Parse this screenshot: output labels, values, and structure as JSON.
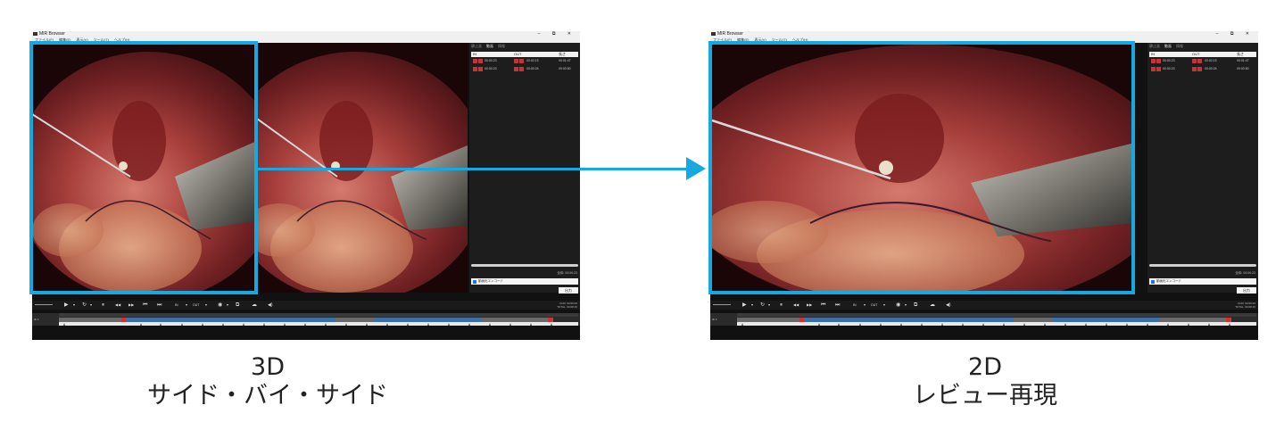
{
  "app": {
    "title": "MIR Browser",
    "window_controls": "– ⧉ ✕",
    "menu": [
      "ファイル(F)",
      "編集(E)",
      "表示(V)",
      "ツール(T)",
      "ヘルプ(H)"
    ],
    "side_tabs": [
      "静止画",
      "動画",
      "情報"
    ],
    "active_tab": 1,
    "clip_columns": [
      "IN",
      "OUT",
      "長さ"
    ],
    "clips": [
      {
        "in": "00:00:23",
        "out": "00:02:15",
        "length": "00:01:47"
      },
      {
        "in": "00:00:23",
        "out": "00:00:24",
        "length": "00:00:50"
      }
    ],
    "side_time": "全体: 00:00:23",
    "encode_label": "動画化エンコード",
    "output_label": "出力",
    "time_readout": [
      "CUR: 00:00:23",
      "TOTAL: 00:08:15"
    ],
    "track_label": "ch 1",
    "control_glyphs": [
      "▶",
      "▾",
      "↻",
      "▾",
      "⏸",
      "◀◀",
      "▶▶",
      "⏮",
      "⏭",
      "IN",
      "▾",
      "OUT",
      "▾",
      "◉",
      "▾",
      "⧉",
      "☁",
      "◀)"
    ]
  },
  "left": {
    "mode": "3D side-by-side"
  },
  "right": {
    "mode": "2D review"
  },
  "captions": {
    "left_line1": "3D",
    "left_line2": "サイド・バイ・サイド",
    "right_line1": "2D",
    "right_line2": "レビュー再現"
  },
  "colors": {
    "accent": "#16a9e1",
    "track_blue": "#3d6fa8",
    "track_grey": "#6a6a6a"
  }
}
